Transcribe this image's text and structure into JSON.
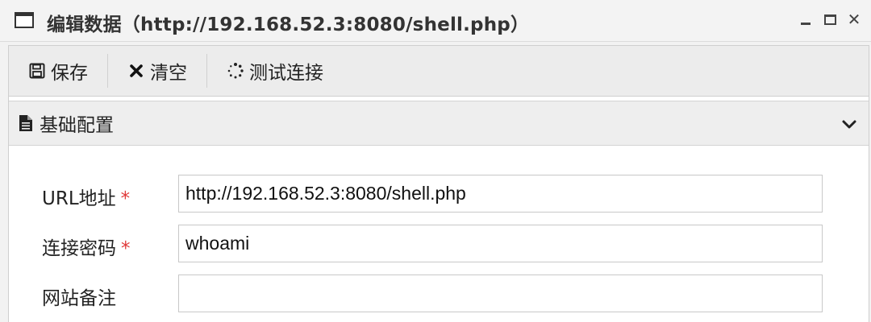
{
  "window": {
    "title": "编辑数据（http://192.168.52.3:8080/shell.php）",
    "controls": {
      "minimize": "minimize-icon",
      "maximize": "maximize-icon",
      "close": "✕"
    }
  },
  "toolbar": {
    "save_label": "保存",
    "clear_label": "清空",
    "test_label": "测试连接"
  },
  "section": {
    "title": "基础配置"
  },
  "form": {
    "url_label": "URL地址",
    "url_value": "http://192.168.52.3:8080/shell.php",
    "password_label": "连接密码",
    "password_value": "whoami",
    "note_label": "网站备注",
    "note_value": "",
    "required_mark": "*"
  },
  "colors": {
    "required": "#e03a3a",
    "toolbar_bg": "#ececec",
    "header_bg": "#eeeeee"
  }
}
